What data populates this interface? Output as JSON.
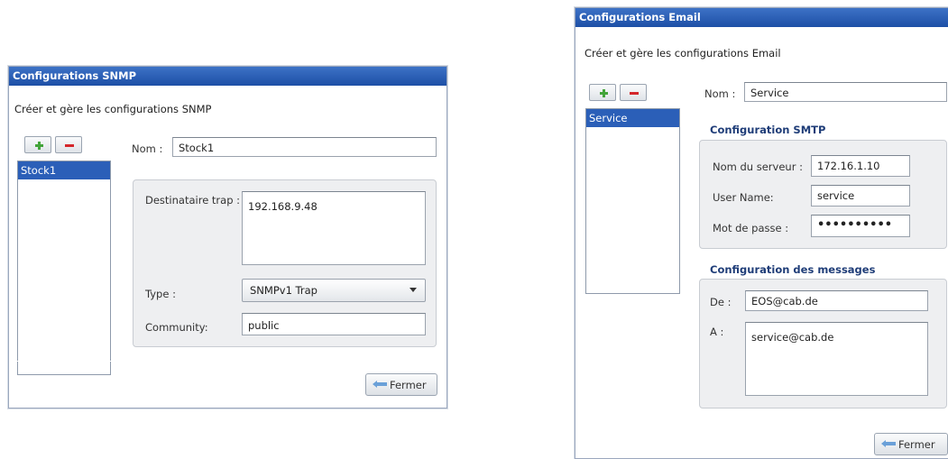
{
  "snmp": {
    "title": "Configurations SNMP",
    "subtitle": "Créer et gère les configurations SNMP",
    "list": [
      "Stock1"
    ],
    "name_label": "Nom :",
    "name_value": "Stock1",
    "trap_label": "Destinataire trap :",
    "trap_value": "192.168.9.48",
    "type_label": "Type :",
    "type_value": "SNMPv1 Trap",
    "community_label": "Community:",
    "community_value": "public",
    "close_label": "Fermer"
  },
  "email": {
    "title": "Configurations Email",
    "subtitle": "Créer et gère les configurations Email",
    "list": [
      "Service"
    ],
    "name_label": "Nom :",
    "name_value": "Service",
    "smtp_title": "Configuration SMTP",
    "server_label": "Nom du serveur :",
    "server_value": "172.16.1.10",
    "user_label": "User Name:",
    "user_value": "service",
    "pass_label": "Mot de passe :",
    "pass_value": "••••••••••",
    "messages_title": "Configuration des messages",
    "from_label": "De :",
    "from_value": "EOS@cab.de",
    "to_label": "A :",
    "to_value": "service@cab.de",
    "close_label": "Fermer"
  },
  "colors": {
    "titlebar": "#2b5fb8",
    "selection": "#2b5fb8",
    "section_title": "#1f3d78",
    "add": "#43a43a",
    "remove": "#d4262b"
  }
}
